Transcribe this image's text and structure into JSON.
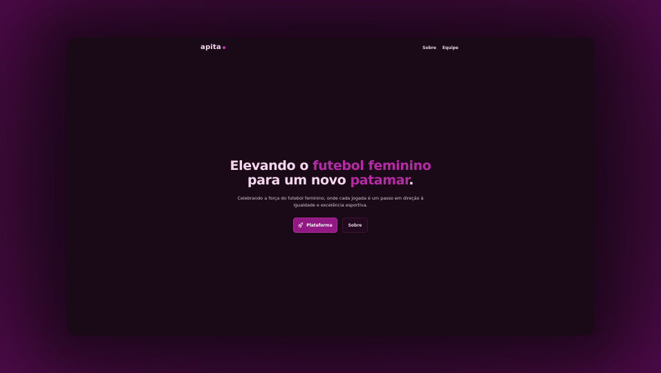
{
  "nav": {
    "logo": "apita",
    "links": [
      "Sobre",
      "Equipe"
    ]
  },
  "hero": {
    "title_line1_part1": "Elevando o ",
    "title_line1_accent": "futebol feminino",
    "title_line2_part1": "para um novo ",
    "title_line2_accent": "patamar",
    "title_line2_end": ".",
    "subtitle": "Celebrando a força do futebol feminino, onde cada jogada é um passo em direção à igualdade e excelência esportiva.",
    "primary_button": "Plataforma",
    "primary_icon": "rocket-icon",
    "secondary_button": "Sobre"
  },
  "colors": {
    "accent": "#b62aa5",
    "button_primary": "#921883",
    "background": "#1a0a17"
  }
}
